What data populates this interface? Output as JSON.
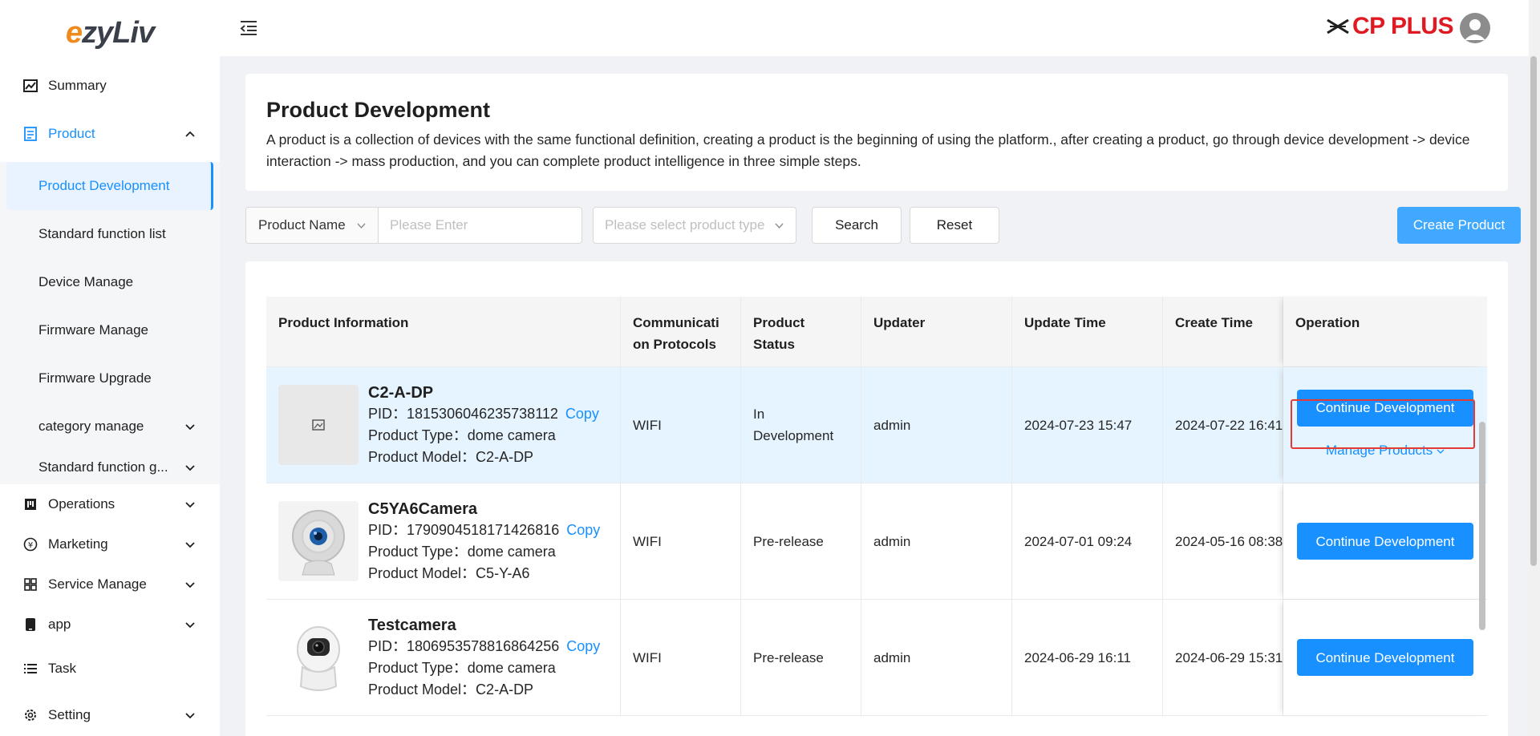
{
  "sidebar": {
    "logo": {
      "prefix": "e",
      "rest": "zyLiv"
    },
    "items": [
      {
        "label": "Summary",
        "icon": "chart-line-icon"
      },
      {
        "label": "Product",
        "icon": "document-icon"
      },
      {
        "label": "Operations",
        "icon": "kanban-icon"
      },
      {
        "label": "Marketing",
        "icon": "yen-circle-icon"
      },
      {
        "label": "Service Manage",
        "icon": "grid-icon"
      },
      {
        "label": "app",
        "icon": "phone-icon"
      },
      {
        "label": "Task",
        "icon": "list-icon"
      },
      {
        "label": "Setting",
        "icon": "gear-icon"
      }
    ],
    "product_sub": [
      "Product Development",
      "Standard function list",
      "Device Manage",
      "Firmware Manage",
      "Firmware Upgrade",
      "category manage",
      "Standard function g..."
    ]
  },
  "header": {
    "brand": "CP PLUS"
  },
  "intro": {
    "title": "Product Development",
    "desc": "A product is a collection of devices with the same functional definition, creating a product is the beginning of using the platform., after creating a product, go through device development -> device interaction -> mass production, and you can complete product intelligence in three simple steps."
  },
  "filters": {
    "field": "Product Name",
    "input_placeholder": "Please Enter",
    "type_placeholder": "Please select product type",
    "search": "Search",
    "reset": "Reset",
    "create": "Create Product"
  },
  "table": {
    "columns": [
      "Product Information",
      "Communication Protocols",
      "Product Status",
      "Updater",
      "Update Time",
      "Create Time",
      "Operation"
    ],
    "col2_line1": "Communicati",
    "col2_line2": "on Protocols",
    "col3_line1": "Product",
    "col3_line2": "Status",
    "rows": [
      {
        "name": "C2-A-DP",
        "pid_label": "PID：",
        "pid": "1815306046235738112",
        "copy": "Copy",
        "type": "Product Type：dome camera",
        "model": "Product Model：C2-A-DP",
        "protocol": "WIFI",
        "status": "In Development",
        "updater": "admin",
        "update_time": "2024-07-23 15:47",
        "create_time": "2024-07-22 16:41",
        "action": "Continue Development",
        "manage": "Manage Products"
      },
      {
        "name": "C5YA6Camera",
        "pid_label": "PID：",
        "pid": "1790904518171426816",
        "copy": "Copy",
        "type": "Product Type：dome camera",
        "model": "Product Model：C5-Y-A6",
        "protocol": "WIFI",
        "status": "Pre-release",
        "updater": "admin",
        "update_time": "2024-07-01 09:24",
        "create_time": "2024-05-16 08:38",
        "action": "Continue Development"
      },
      {
        "name": "Testcamera",
        "pid_label": "PID：",
        "pid": "1806953578816864256",
        "copy": "Copy",
        "type": "Product Type：dome camera",
        "model": "Product Model：C2-A-DP",
        "protocol": "WIFI",
        "status": "Pre-release",
        "updater": "admin",
        "update_time": "2024-06-29 16:11",
        "create_time": "2024-06-29 15:31",
        "action": "Continue Development"
      }
    ]
  },
  "colors": {
    "primary": "#1890ff",
    "brand_red": "#e01a22",
    "logo_orange": "#f08a1c",
    "highlight_row": "#e6f4ff"
  }
}
